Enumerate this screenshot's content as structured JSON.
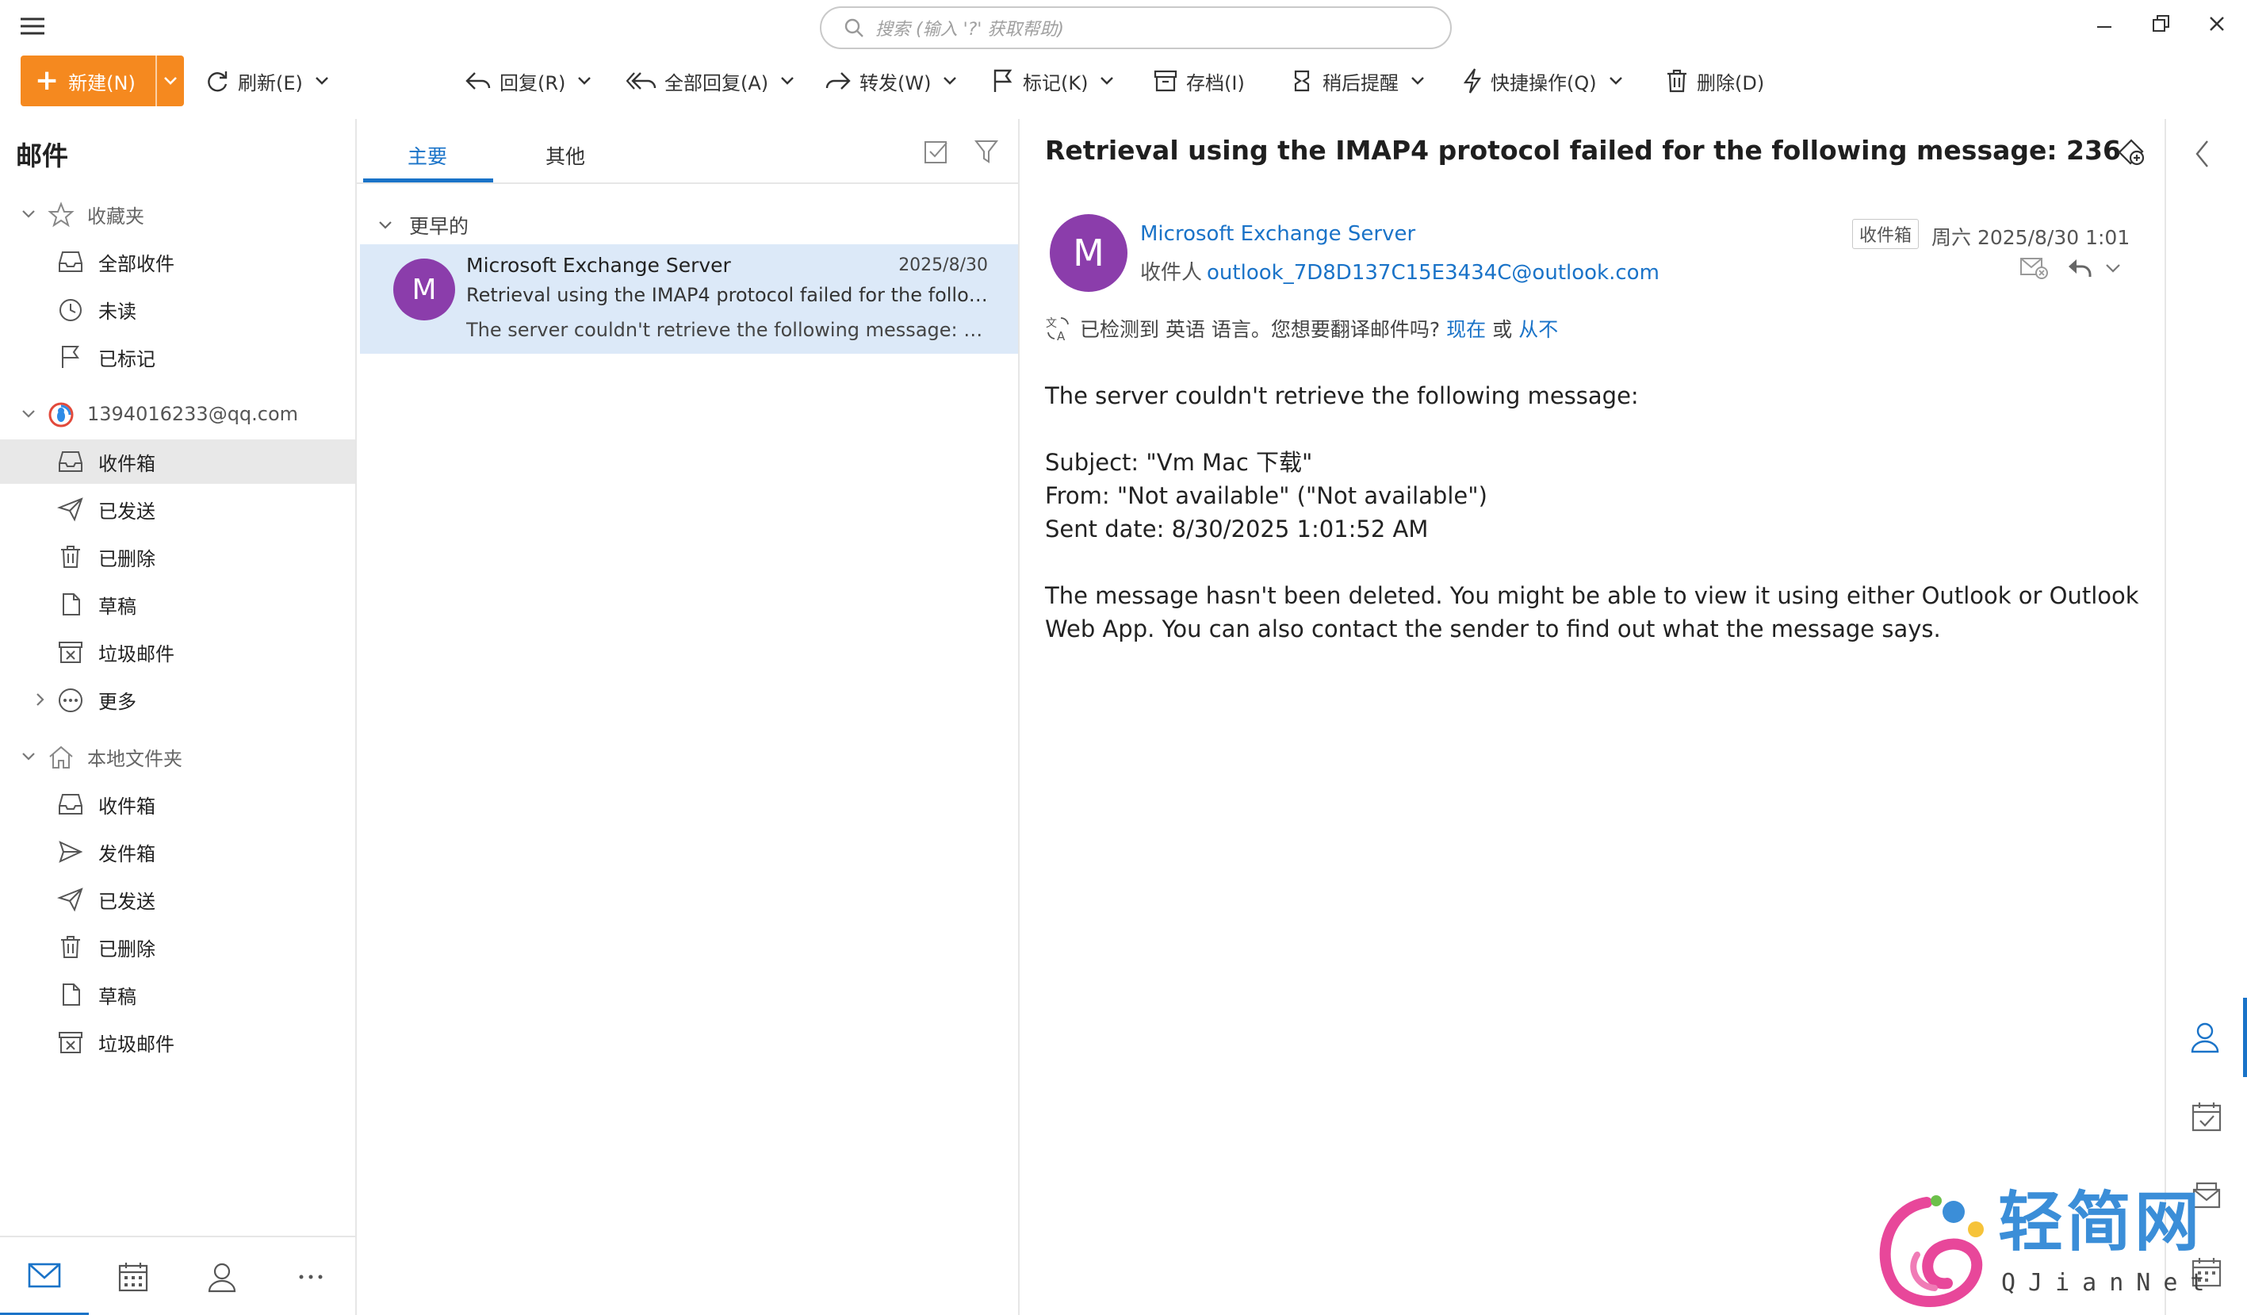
{
  "search": {
    "placeholder": "搜索 (输入 '?' 获取帮助)"
  },
  "toolbar": {
    "new_label": "新建(N)",
    "refresh_label": "刷新(E)",
    "reply_label": "回复(R)",
    "reply_all_label": "全部回复(A)",
    "forward_label": "转发(W)",
    "flag_label": "标记(K)",
    "archive_label": "存档(I)",
    "snooze_label": "稍后提醒",
    "quick_label": "快捷操作(Q)",
    "delete_label": "删除(D)"
  },
  "sidebar": {
    "title": "邮件",
    "favorites": {
      "label": "收藏夹",
      "items": [
        "全部收件",
        "未读",
        "已标记"
      ]
    },
    "account": {
      "label": "1394016233@qq.com",
      "items": [
        "收件箱",
        "已发送",
        "已删除",
        "草稿",
        "垃圾邮件",
        "更多"
      ]
    },
    "local": {
      "label": "本地文件夹",
      "items": [
        "收件箱",
        "发件箱",
        "已发送",
        "已删除",
        "草稿",
        "垃圾邮件"
      ]
    }
  },
  "list": {
    "tabs": [
      "主要",
      "其他"
    ],
    "group_label": "更早的",
    "message": {
      "avatar_letter": "M",
      "from": "Microsoft Exchange Server",
      "date": "2025/8/30",
      "subject": "Retrieval using the IMAP4 protocol failed for the following message: 236",
      "preview": "The server couldn't retrieve the following message: Subject: \"Vm Mac 下载\""
    }
  },
  "reader": {
    "subject": "Retrieval using the IMAP4 protocol failed for the following message: 236",
    "avatar_letter": "M",
    "from": "Microsoft Exchange Server",
    "to_label": "收件人",
    "to_address": "outlook_7D8D137C15E3434C@outlook.com",
    "folder_badge": "收件箱",
    "date": "周六 2025/8/30 1:01",
    "translate_text": "已检测到 英语 语言。您想要翻译邮件吗?",
    "translate_now": "现在",
    "translate_or": "或",
    "translate_never": "从不",
    "body": {
      "line1": "The server couldn't retrieve the following message:",
      "subject_line": "Subject: \"Vm Mac 下载\"",
      "from_line": "From: \"Not available\" (\"Not available\")",
      "sent_line": "Sent date: 8/30/2025 1:01:52 AM",
      "para2": "The message hasn't been deleted. You might be able to view it using either Outlook or Outlook Web App. You can also contact the sender to find out what the message says."
    }
  },
  "watermark": {
    "text": "轻简网",
    "sub": "QJianNet"
  },
  "colors": {
    "accent": "#1a73c8",
    "new_button": "#f5891f",
    "avatar": "#8b3dab",
    "selected_row": "#dce9f8"
  }
}
